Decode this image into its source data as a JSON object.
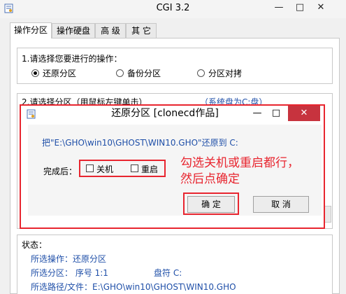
{
  "window": {
    "title": "CGI 3.2",
    "minimize": "—",
    "maximize": "□",
    "close": "✕"
  },
  "tabs": [
    "操作分区",
    "操作硬盘",
    "高 级",
    "其 它"
  ],
  "operation": {
    "label": "1.请选择您要进行的操作：",
    "options": [
      "还原分区",
      "备份分区",
      "分区对拷"
    ],
    "selected": "还原分区"
  },
  "partition": {
    "label": "2.请选择分区（用鼠标左键单击）",
    "note": "（系统盘为C:盘）"
  },
  "dialog": {
    "title": "还原分区  [clonecd作品]",
    "close": "✕",
    "message": "把\"E:\\GHO\\win10\\GHOST\\WIN10.GHO\"还原到 C:",
    "after_label": "完成后：",
    "shutdown_label": "关机",
    "restart_label": "重启",
    "shutdown_checked": false,
    "restart_checked": false,
    "ok_label": "确 定",
    "cancel_label": "取 消"
  },
  "annotation": {
    "line1": "勾选关机或重启都行，",
    "line2": "然后点确定"
  },
  "status": {
    "label": "状态：",
    "op": "所选操作：还原分区",
    "part": "所选分区：  序号 1:1",
    "drive": "盘符 C:",
    "path": "所选路径/文件：E:\\GHO\\win10\\GHOST\\WIN10.GHO"
  },
  "colors": {
    "annotation_red": "#e8252f",
    "close_red": "#c7333e",
    "text_blue": "#1f4fa8"
  }
}
